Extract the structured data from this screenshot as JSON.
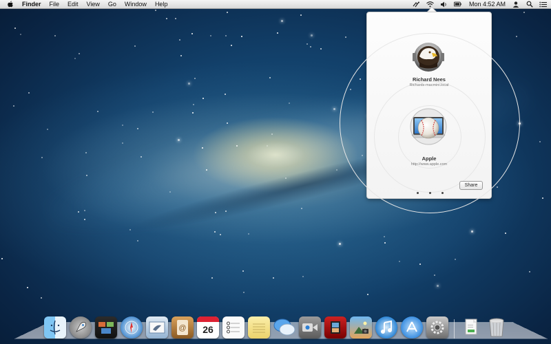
{
  "menubar": {
    "apple_icon": "apple-logo-icon",
    "app_name": "Finder",
    "items": [
      "File",
      "Edit",
      "View",
      "Go",
      "Window",
      "Help"
    ],
    "status_icons": [
      "airdrop-icon",
      "wifi-icon",
      "volume-icon",
      "battery-icon"
    ],
    "clock": "Mon 4:52 AM",
    "user_icon": "user-icon",
    "spotlight_icon": "spotlight-search-icon",
    "notifications_icon": "notification-center-icon"
  },
  "popover": {
    "user": {
      "name": "Richard Nees",
      "host": "Richards-macmini.local",
      "icon": "eagle-avatar-icon"
    },
    "server": {
      "name": "Apple",
      "url": "http://www.apple.com",
      "icon": "baseball-app-icon"
    },
    "share_label": "Share",
    "page_dots": 3
  },
  "dock": {
    "apps": [
      {
        "name": "Finder",
        "icon": "finder-icon"
      },
      {
        "name": "Launchpad",
        "icon": "launchpad-icon"
      },
      {
        "name": "Mission Control",
        "icon": "mission-control-icon"
      },
      {
        "name": "Safari",
        "icon": "safari-icon"
      },
      {
        "name": "Mail",
        "icon": "mail-icon"
      },
      {
        "name": "Contacts",
        "icon": "contacts-icon"
      },
      {
        "name": "Calendar",
        "icon": "calendar-icon",
        "badge": "26"
      },
      {
        "name": "Reminders",
        "icon": "reminders-icon"
      },
      {
        "name": "Notes",
        "icon": "notes-icon"
      },
      {
        "name": "Messages",
        "icon": "messages-icon"
      },
      {
        "name": "FaceTime",
        "icon": "facetime-icon"
      },
      {
        "name": "Photo Booth",
        "icon": "photo-booth-icon"
      },
      {
        "name": "iPhoto",
        "icon": "iphoto-icon"
      },
      {
        "name": "iTunes",
        "icon": "itunes-icon"
      },
      {
        "name": "App Store",
        "icon": "app-store-icon"
      },
      {
        "name": "System Preferences",
        "icon": "system-preferences-icon"
      }
    ],
    "right": [
      {
        "name": "Documents",
        "icon": "documents-stack-icon"
      },
      {
        "name": "Trash",
        "icon": "trash-icon"
      }
    ]
  },
  "colors": {
    "menubar": "#e6e6e6",
    "wallpaper_deep": "#0a2545",
    "galaxy_core": "#fff5c8"
  }
}
